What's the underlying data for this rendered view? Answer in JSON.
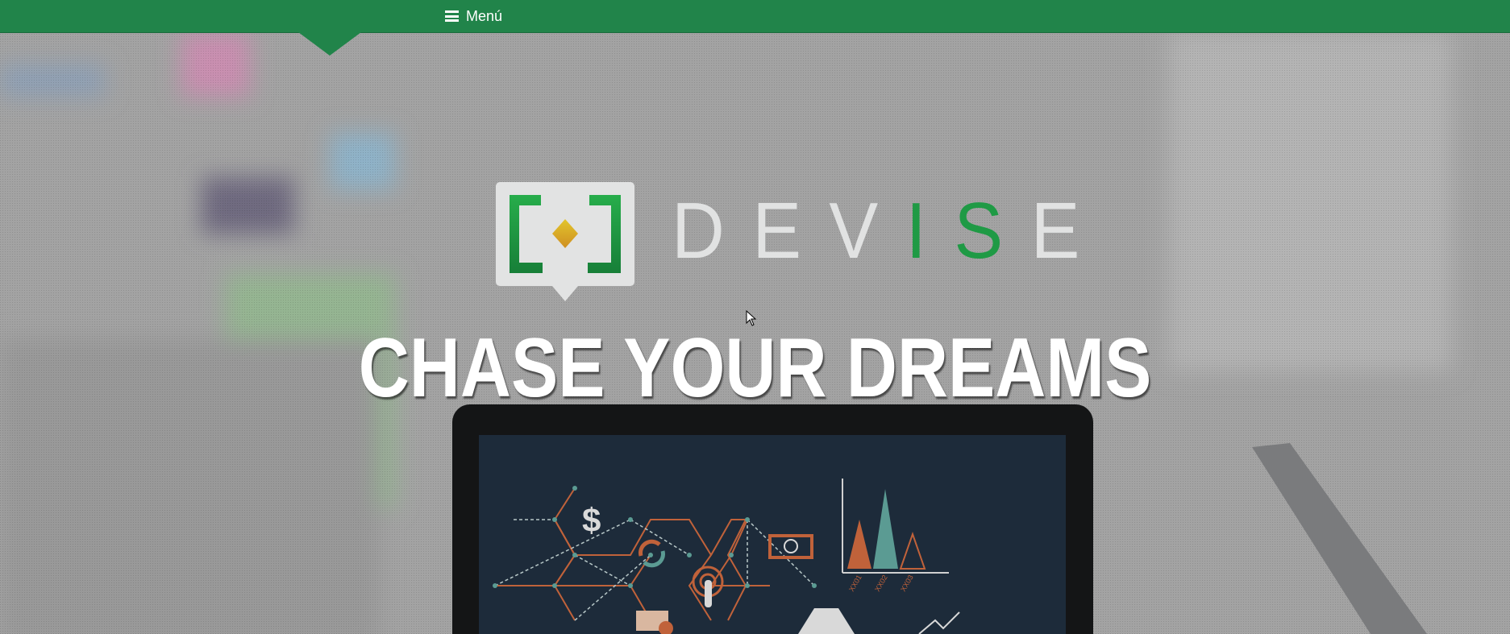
{
  "nav": {
    "menu_label": "Menú",
    "menu_icon": "hamburger-icon",
    "color": "#21844a"
  },
  "hero": {
    "brand_prefix": "DEV",
    "brand_highlight": "IS",
    "brand_suffix": "E",
    "headline": "CHASE YOUR DREAMS",
    "brand_green": "#1f9a45",
    "logo_accent": "#d4a52a"
  },
  "laptop_screen": {
    "chart_labels": [
      "XX01",
      "XX02",
      "XX03"
    ],
    "currency_symbol": "$"
  }
}
